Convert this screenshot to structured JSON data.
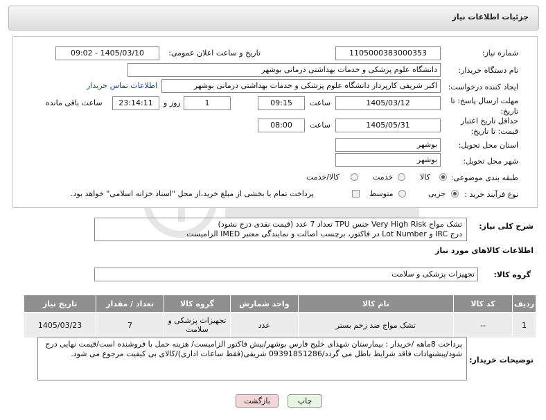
{
  "header": {
    "title": "جزئیات اطلاعات نیاز"
  },
  "form": {
    "need_number": {
      "label": "شماره نیاز:",
      "value": "1105000383000353"
    },
    "announce_datetime": {
      "label": "تاریخ و ساعت اعلان عمومی:",
      "value": "1405/03/10 - 09:02"
    },
    "buyer_org": {
      "label": "نام دستگاه خریدار:",
      "value": "دانشگاه علوم پزشکی و خدمات بهداشتی درمانی بوشهر"
    },
    "creator": {
      "label": "ایجاد کننده درخواست:",
      "value": "اکبر شریفی کارپرداز دانشگاه علوم پزشکی و خدمات بهداشتی درمانی بوشهر",
      "contact_link": "اطلاعات تماس خریدار"
    },
    "reply_deadline": {
      "label": "مهلت ارسال پاسخ: تا تاریخ:",
      "date": "1405/03/12",
      "time_label": "ساعت",
      "time": "09:15",
      "days": "1",
      "days_label": "روز و",
      "remaining": "23:14:11",
      "remaining_label": "ساعت باقی مانده"
    },
    "price_validity": {
      "label": "حداقل تاریخ اعتبار قیمت: تا تاریخ:",
      "date": "1405/05/31",
      "time_label": "ساعت",
      "time": "08:00"
    },
    "delivery_province": {
      "label": "استان محل تحویل:",
      "value": "بوشهر"
    },
    "delivery_city": {
      "label": "شهر محل تحویل:",
      "value": "بوشهر"
    },
    "category": {
      "label": "طبقه بندی موضوعی:",
      "options": [
        "کالا",
        "خدمت",
        "کالا/خدمت"
      ],
      "selected": "کالا"
    },
    "purchase_type": {
      "label": "نوع فرآیند خرید :",
      "options": [
        "جزیی",
        "متوسط"
      ],
      "selected": "جزیی",
      "payment_note": "پرداخت تمام یا بخشی از مبلغ خرید،از محل \"اسناد خزانه اسلامی\" خواهد بود."
    }
  },
  "summary": {
    "label": "شرح کلی نیاز:",
    "line1": "تشک مواج Very High Risk جنس TPU تعداد 7 عدد (قیمت نقدی درج نشود)",
    "line2": "درج IRC و Lot Number در فاکتور، برچسب اصالت و نمایندگی معتبر IMED الزامیست"
  },
  "goods": {
    "section_title": "اطلاعات کالاهای مورد نیاز",
    "group_label": "گروه کالا:",
    "group_value": "تجهیزات پزشکی و سلامت",
    "columns": [
      "ردیف",
      "کد کالا",
      "نام کالا",
      "واحد شمارش",
      "گروه کالا",
      "تعداد / مقدار",
      "تاریخ نیاز"
    ],
    "rows": [
      {
        "index": "1",
        "code": "--",
        "name": "تشک مواج ضد زخم بستر",
        "unit": "عدد",
        "group": "تجهیزات پزشکی و سلامت",
        "qty": "7",
        "date": "1405/03/23"
      }
    ]
  },
  "buyer_notes": {
    "label": "توضیحات خریدار:",
    "text": "پرداخت 8ماهه /خریدار : بیمارستان شهدای خلیج فارس بوشهر/پیش فاکتور الزامیست/ هزینه حمل با فروشنده است/قیمت نهایی درج شود/پیشنهادات فاقد شرایط باطل می گردد/09391851286 شریفی(فقط ساعات اداری)/کالای بی کیفیت مرجوع می شود."
  },
  "buttons": {
    "print": "چاپ",
    "back": "بازگشت"
  },
  "colors": {
    "header_bg": "#e2e2e2",
    "table_header": "#8f8f8f",
    "table_cell": "#ececec",
    "link": "#1a3f9c",
    "back_button": "#f5d6d6",
    "print_button": "#e9f5e3"
  }
}
